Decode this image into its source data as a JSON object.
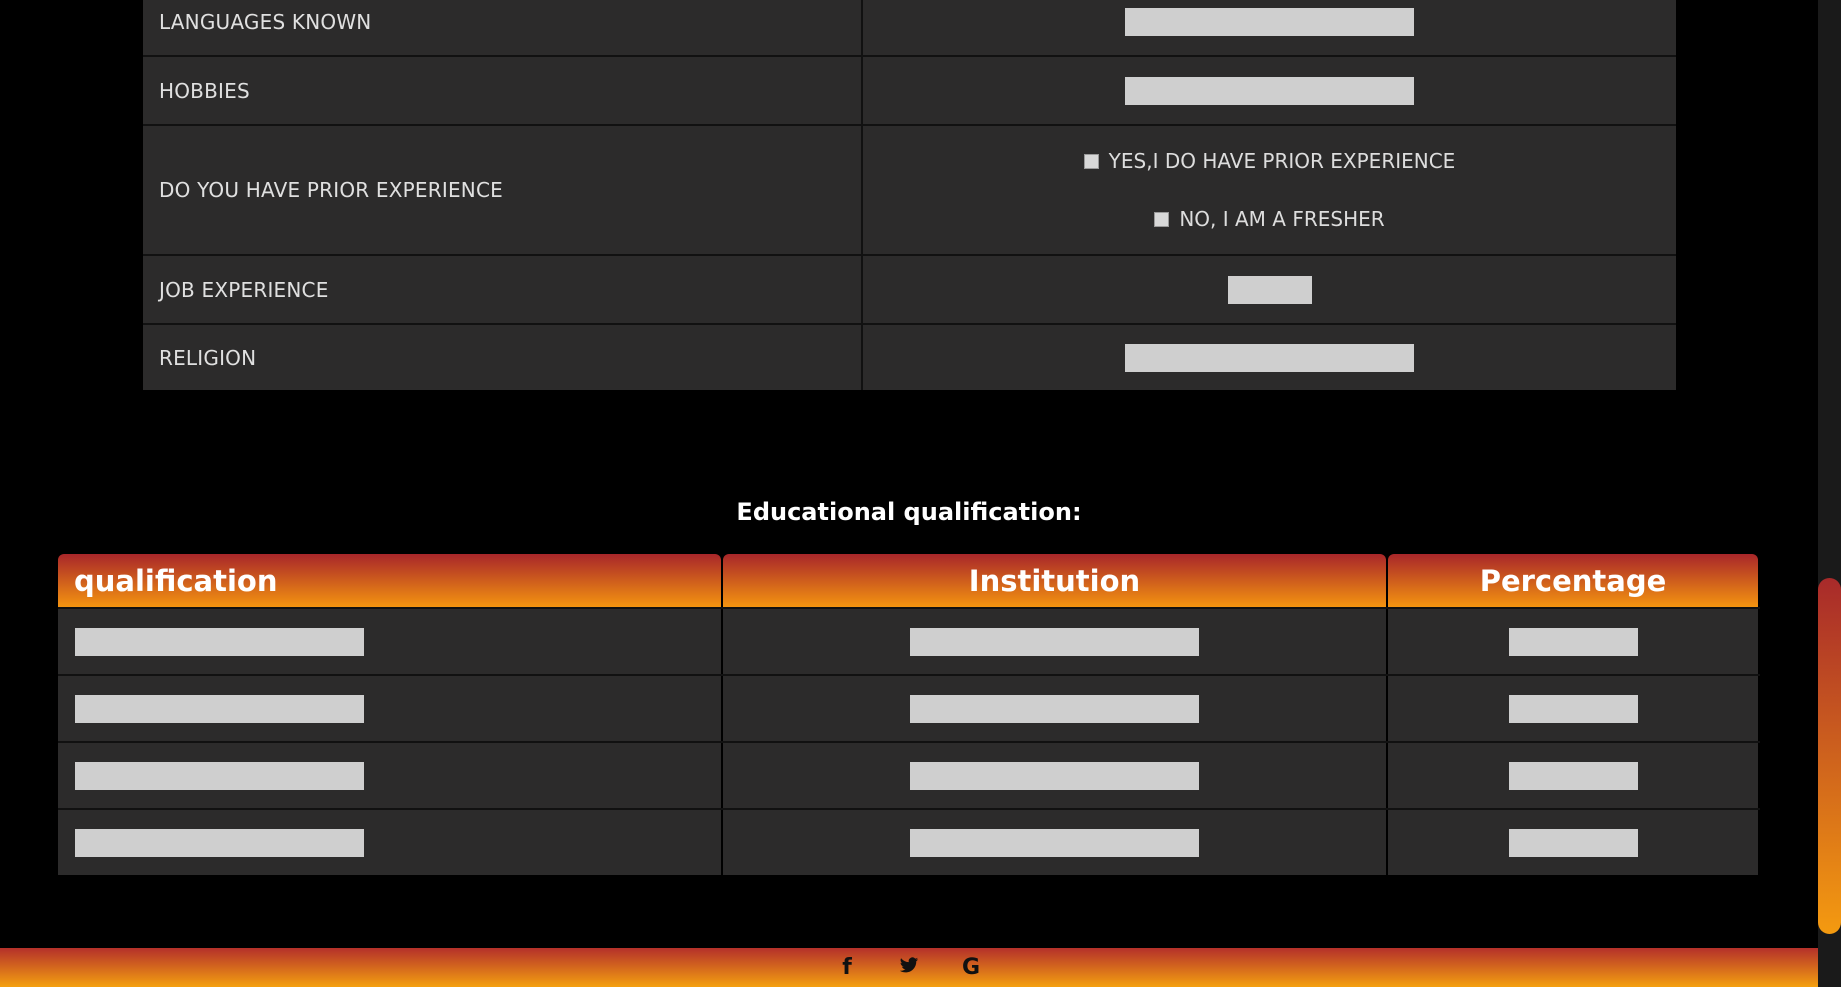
{
  "form": {
    "rows": [
      {
        "label": "LANGUAGES KNOWN"
      },
      {
        "label": "HOBBIES"
      },
      {
        "label": "DO YOU HAVE PRIOR EXPERIENCE",
        "options": [
          "YES,I DO HAVE PRIOR EXPERIENCE",
          "NO, I AM A FRESHER"
        ]
      },
      {
        "label": "JOB EXPERIENCE"
      },
      {
        "label": "RELIGION"
      }
    ]
  },
  "education": {
    "title": "Educational qualification:",
    "headers": [
      "qualification",
      "Institution",
      "Percentage"
    ]
  },
  "footer": {
    "icons": [
      "f",
      "t",
      "G"
    ]
  },
  "colors": {
    "accent_top": "#a8262a",
    "accent_bottom": "#f49410",
    "panel": "#2c2b2b",
    "input": "#cfcfcf"
  }
}
